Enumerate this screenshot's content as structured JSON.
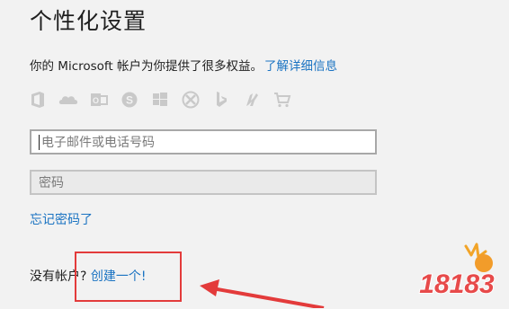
{
  "page": {
    "title": "个性化设置",
    "intro_text": "你的 Microsoft 帐户为你提供了很多权益。",
    "intro_link": "了解详细信息"
  },
  "service_icons": [
    "office-icon",
    "onedrive-icon",
    "outlook-icon",
    "skype-icon",
    "windows-icon",
    "xbox-icon",
    "bing-icon",
    "msn-icon",
    "store-icon"
  ],
  "form": {
    "email_placeholder": "电子邮件或电话号码",
    "password_placeholder": "密码",
    "forgot_password": "忘记密码了"
  },
  "signup": {
    "prompt": "没有帐户?",
    "create_link": "创建一个!"
  },
  "annotation": {
    "color": "#e33b3b"
  },
  "watermark": {
    "text": "18183"
  }
}
